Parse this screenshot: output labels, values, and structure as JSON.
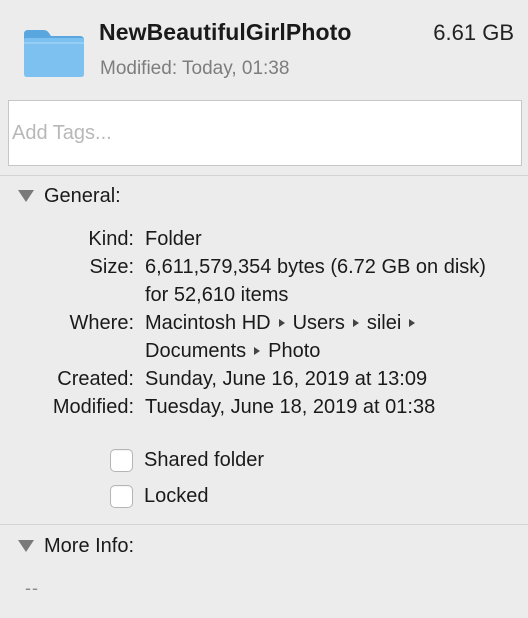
{
  "header": {
    "name": "NewBeautifulGirlPhoto",
    "size": "6.61 GB",
    "modified_line": "Modified: Today, 01:38",
    "icon": "folder-icon",
    "folder_color": "#6cb6ea"
  },
  "tags": {
    "placeholder": "Add Tags...",
    "value": ""
  },
  "general": {
    "title": "General:",
    "kind_label": "Kind:",
    "kind_value": "Folder",
    "size_label": "Size:",
    "size_value": "6,611,579,354 bytes (6.72 GB on disk) for 52,610 items",
    "where_label": "Where:",
    "where_path": [
      "Macintosh HD",
      "Users",
      "silei",
      "Documents",
      "Photo"
    ],
    "created_label": "Created:",
    "created_value": "Sunday, June 16, 2019 at 13:09",
    "modified_label": "Modified:",
    "modified_value": "Tuesday, June 18, 2019 at 01:38",
    "shared_folder_label": "Shared folder",
    "shared_folder_checked": false,
    "locked_label": "Locked",
    "locked_checked": false
  },
  "more_info": {
    "title": "More Info:",
    "value": "--"
  }
}
